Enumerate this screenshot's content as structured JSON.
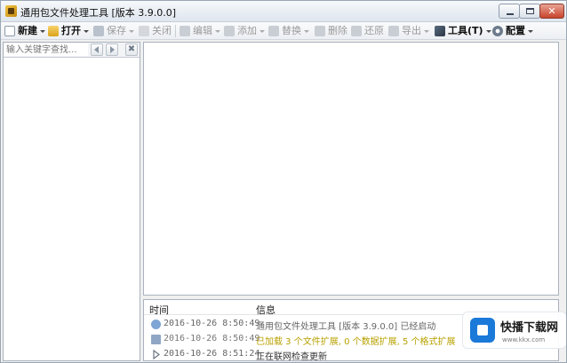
{
  "window": {
    "title": "通用包文件处理工具 [版本 3.9.0.0]"
  },
  "toolbar": {
    "items": [
      {
        "label": "新建",
        "icon": "new-file-icon",
        "enabled": true,
        "dropdown": true
      },
      {
        "label": "打开",
        "icon": "folder-open-icon",
        "enabled": true,
        "dropdown": true
      },
      {
        "label": "保存",
        "icon": "save-icon",
        "enabled": false,
        "dropdown": true
      },
      {
        "label": "关闭",
        "icon": "close-document-icon",
        "enabled": false,
        "dropdown": false
      },
      {
        "label": "编辑",
        "icon": "edit-icon",
        "enabled": false,
        "dropdown": true
      },
      {
        "label": "添加",
        "icon": "add-icon",
        "enabled": false,
        "dropdown": true
      },
      {
        "label": "替换",
        "icon": "replace-icon",
        "enabled": false,
        "dropdown": true
      },
      {
        "label": "删除",
        "icon": "delete-icon",
        "enabled": false,
        "dropdown": false
      },
      {
        "label": "还原",
        "icon": "restore-icon",
        "enabled": false,
        "dropdown": false
      },
      {
        "label": "导出",
        "icon": "export-icon",
        "enabled": false,
        "dropdown": true
      },
      {
        "label": "工具(T)",
        "icon": "tools-icon",
        "enabled": true,
        "dropdown": true
      },
      {
        "label": "配置",
        "icon": "settings-icon",
        "enabled": true,
        "dropdown": true
      }
    ]
  },
  "search": {
    "placeholder": "输入关键字查找..."
  },
  "log": {
    "col_time": "时间",
    "col_info": "信息",
    "rows": [
      {
        "icon": "info-icon",
        "time": "2016-10-26 8:50:49",
        "message": "通用包文件处理工具 [版本 3.9.0.0] 已经启动"
      },
      {
        "icon": "monitor-icon",
        "time": "2016-10-26 8:50:49",
        "message": "已加载 3 个文件扩展, 0 个数据扩展, 5 个格式扩展"
      },
      {
        "icon": "play-icon",
        "time": "2016-10-26 8:51:24",
        "message": "正在联网检查更新"
      }
    ]
  },
  "watermark": {
    "name": "快播下载网",
    "url": "www.kkx.com"
  },
  "colors": {
    "accent": "#1a79d9",
    "warn_text": "#b8a100"
  }
}
